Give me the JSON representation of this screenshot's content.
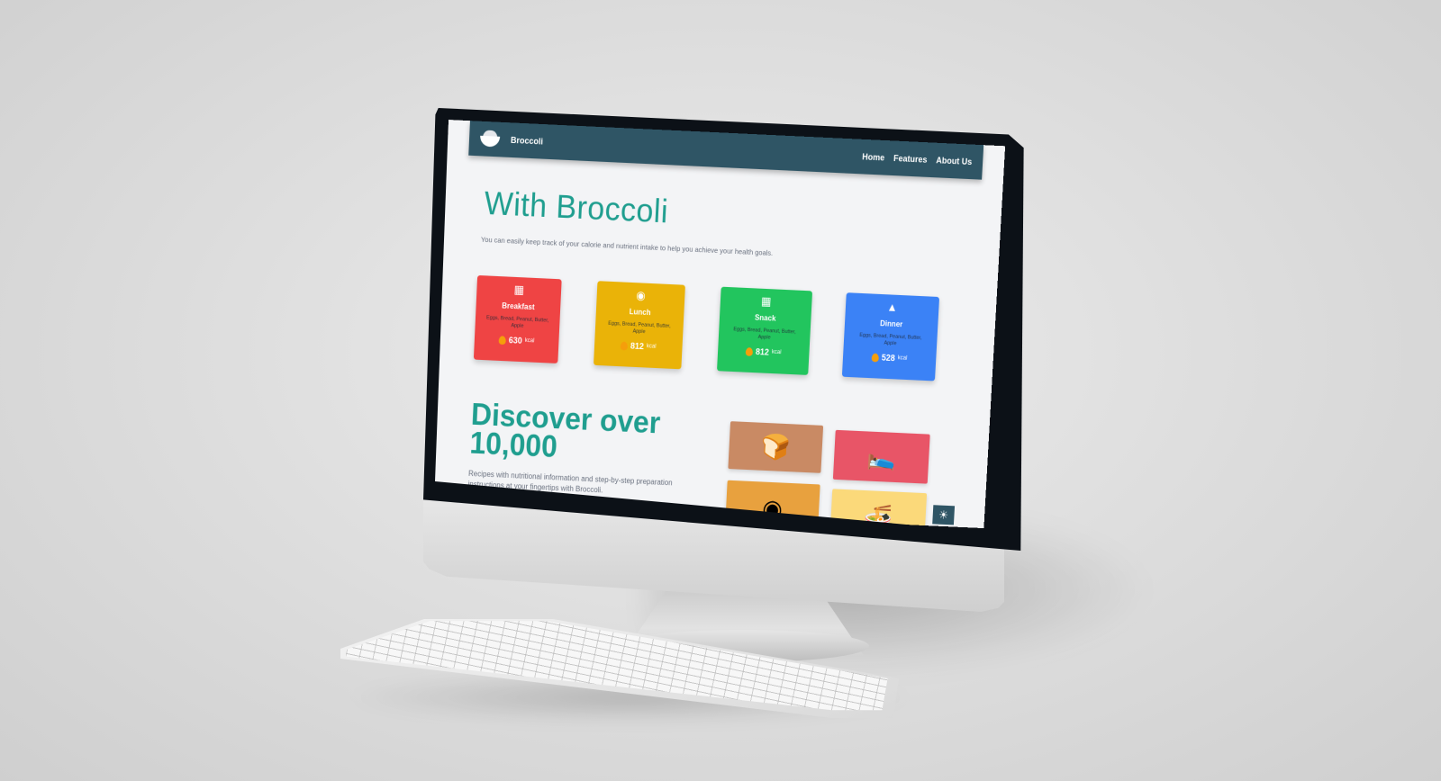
{
  "nav": {
    "brand": "Broccoli",
    "links": [
      "Home",
      "Features",
      "About Us"
    ]
  },
  "hero": {
    "title": "With Broccoli",
    "subtitle": "You can easily keep track of your calorie and nutrient intake to help you achieve your health goals."
  },
  "cards": [
    {
      "title": "Breakfast",
      "items": "Eggs, Bread, Peanut, Butter, Apple",
      "kcal": "630",
      "unit": "kcal",
      "color": "#ef4444",
      "icon": "breakfast-icon"
    },
    {
      "title": "Lunch",
      "items": "Eggs, Bread, Peanut, Butter, Apple",
      "kcal": "812",
      "unit": "kcal",
      "color": "#eab308",
      "icon": "lunch-icon"
    },
    {
      "title": "Snack",
      "items": "Eggs, Bread, Peanut, Butter, Apple",
      "kcal": "812",
      "unit": "kcal",
      "color": "#22c55e",
      "icon": "snack-icon"
    },
    {
      "title": "Dinner",
      "items": "Eggs, Bread, Peanut, Butter, Apple",
      "kcal": "528",
      "unit": "kcal",
      "color": "#3b82f6",
      "icon": "dinner-icon"
    }
  ],
  "discover": {
    "title_line1": "Discover over",
    "title_line2": "10,000",
    "subtitle": "Recipes with nutritional information and step-by-step preparation instructions at your fingertips with Broccoli."
  },
  "tiles": [
    {
      "icon": "bread-icon",
      "color": "#c98a64"
    },
    {
      "icon": "serving-dish-icon",
      "color": "#e85567"
    },
    {
      "icon": "chips-icon",
      "color": "#e8a13e"
    },
    {
      "icon": "noodle-dish-icon",
      "color": "#fbd97a"
    }
  ],
  "theme_toggle": {
    "icon": "sun-icon"
  }
}
